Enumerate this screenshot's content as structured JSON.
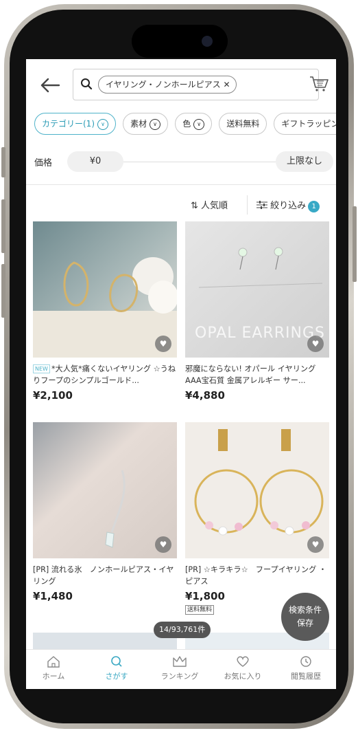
{
  "colors": {
    "accent": "#38a9c6",
    "text": "#333333"
  },
  "header": {
    "back_icon": "arrow-left-icon",
    "search_icon": "magnifier-icon",
    "query_chip": "イヤリング・ノンホールピアス ✕",
    "cart_icon": "cart-icon"
  },
  "filters": [
    {
      "label": "カテゴリー(1)",
      "active": true
    },
    {
      "label": "素材"
    },
    {
      "label": "色"
    },
    {
      "label": "送料無料"
    },
    {
      "label": "ギフトラッピン"
    }
  ],
  "price": {
    "label": "価格",
    "min": "¥0",
    "max": "上限なし"
  },
  "sort": {
    "sort_label": "⇅ 人気順",
    "refine_label": "絞り込み",
    "refine_count": "1"
  },
  "products": [
    {
      "badge": "NEW",
      "title": "*大人気*痛くないイヤリング ☆うねりフープのシンプルゴールド...",
      "price": "¥2,100"
    },
    {
      "title": "邪魔にならない! オパール イヤリング AAA宝石質 金属アレルギー サー...",
      "price": "¥4,880",
      "image_text": "OPAL EARRINGS"
    },
    {
      "title": "[PR] 流れる氷　ノンホールピアス・イヤリング",
      "price": "¥1,480"
    },
    {
      "title": "[PR] ☆キラキラ☆　フープイヤリング ・ ピアス",
      "price": "¥1,800",
      "shipping": "送料無料"
    }
  ],
  "result_counter": "14/93,761件",
  "save_search": {
    "line1": "検索条件",
    "line2": "保存"
  },
  "nav": [
    {
      "label": "ホーム",
      "icon": "home-icon"
    },
    {
      "label": "さがす",
      "icon": "search-icon",
      "active": true
    },
    {
      "label": "ランキング",
      "icon": "crown-icon"
    },
    {
      "label": "お気に入り",
      "icon": "heart-icon"
    },
    {
      "label": "閲覧履歴",
      "icon": "history-icon"
    }
  ]
}
